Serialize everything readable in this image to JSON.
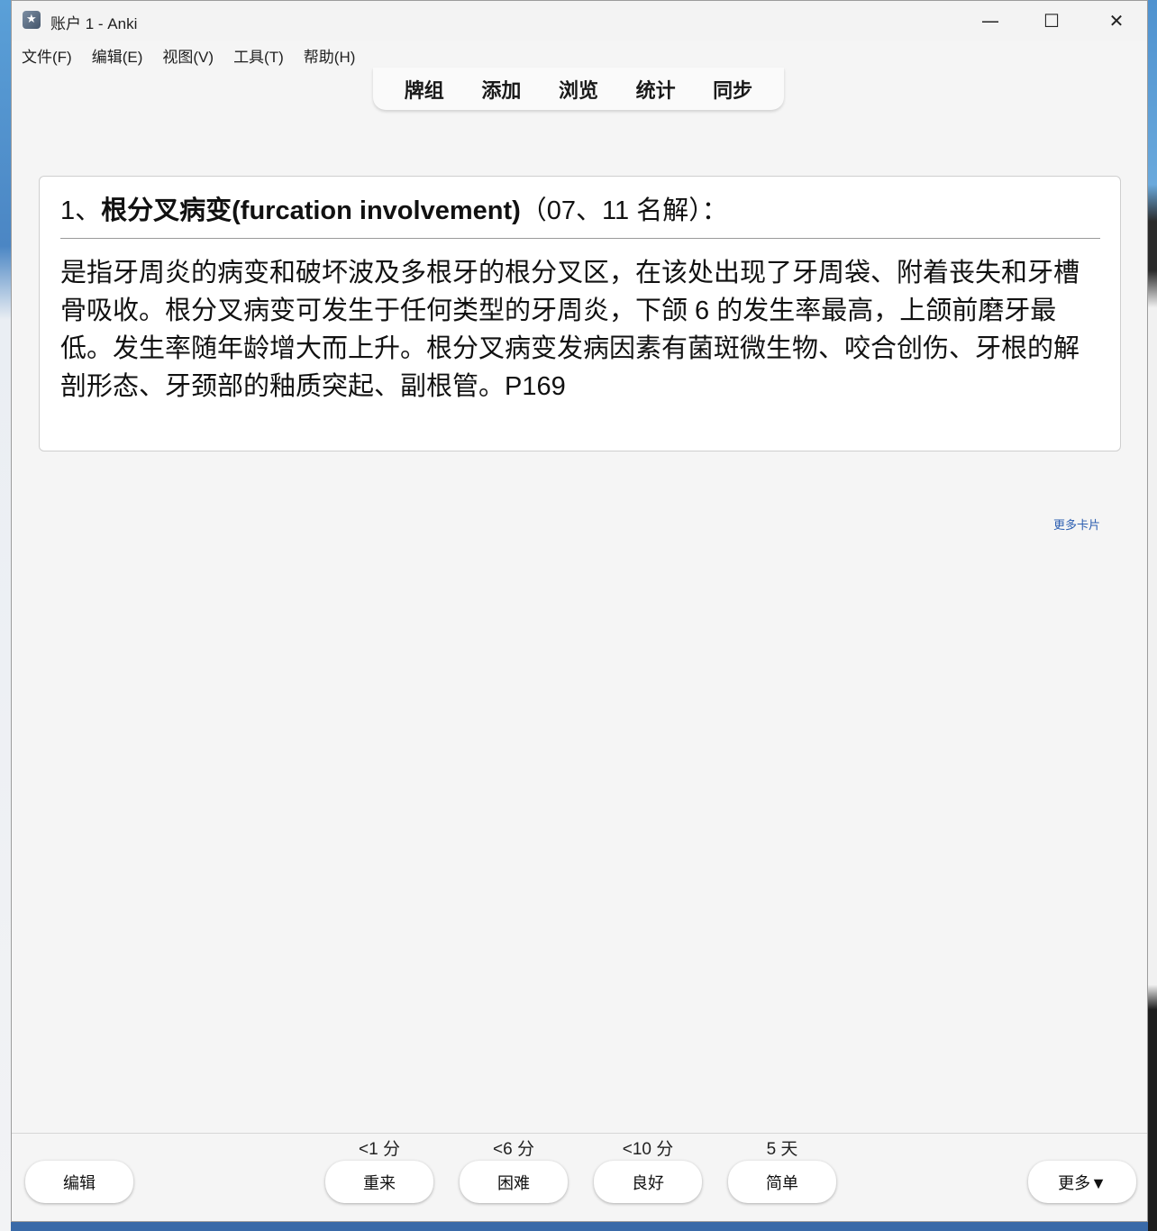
{
  "window": {
    "title": "账户 1 - Anki",
    "controls": {
      "minimize": "—",
      "maximize": "☐",
      "close": "✕"
    }
  },
  "menu": [
    "文件(F)",
    "编辑(E)",
    "视图(V)",
    "工具(T)",
    "帮助(H)"
  ],
  "toolbar": [
    "牌组",
    "添加",
    "浏览",
    "统计",
    "同步"
  ],
  "card": {
    "front_prefix": "1、",
    "front_bold": "根分叉病变(furcation involvement)",
    "front_suffix": "（07、11 名解）：",
    "back": "是指牙周炎的病变和破坏波及多根牙的根分叉区，在该处出现了牙周袋、附着丧失和牙槽骨吸收。根分叉病变可发生于任何类型的牙周炎，下颌 6 的发生率最高，上颌前磨牙最低。发生率随年龄增大而上升。根分叉病变发病因素有菌斑微生物、咬合创伤、牙根的解剖形态、牙颈部的釉质突起、副根管。P169"
  },
  "more_cards": "更多卡片",
  "bottom": {
    "edit": "编辑",
    "more": "更多▼",
    "answers": [
      {
        "interval": "<1 分",
        "label": "重来"
      },
      {
        "interval": "<6 分",
        "label": "困难"
      },
      {
        "interval": "<10 分",
        "label": "良好"
      },
      {
        "interval": "5 天",
        "label": "简单"
      }
    ]
  }
}
